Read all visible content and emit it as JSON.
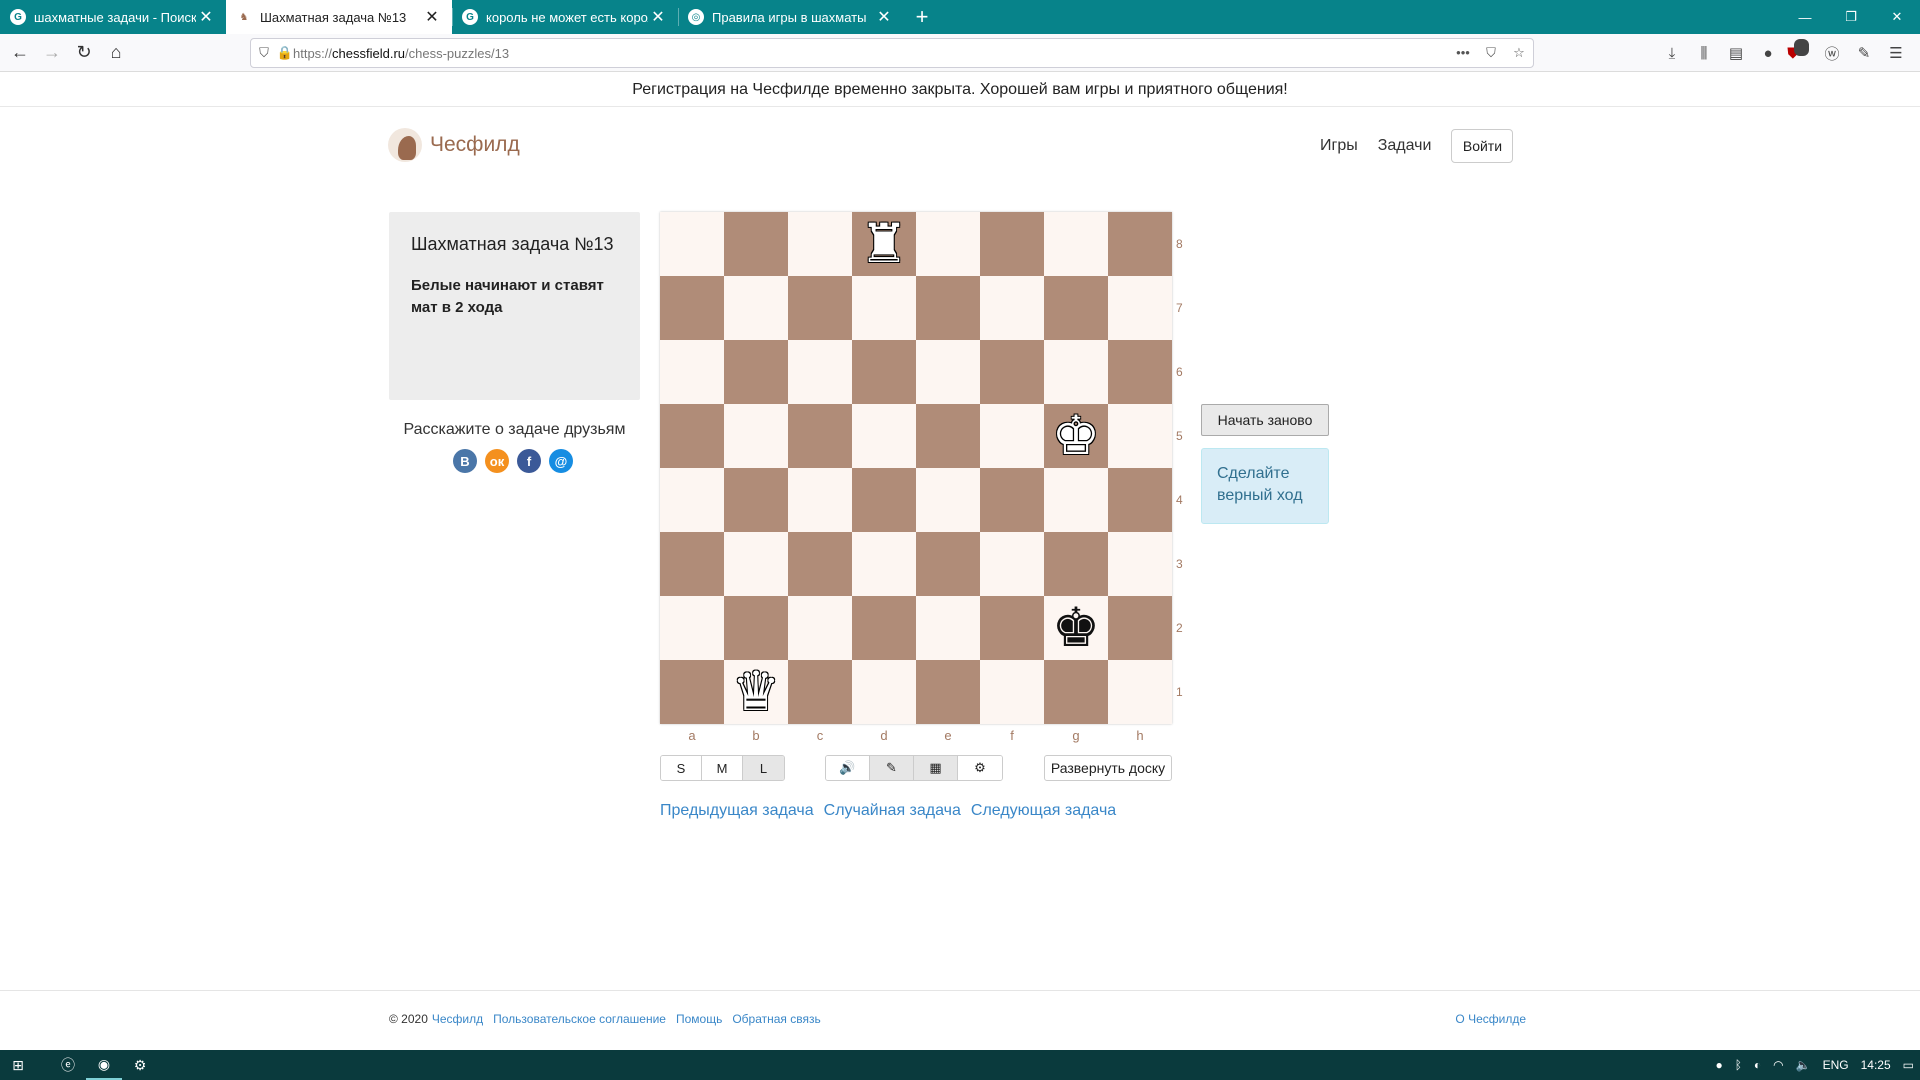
{
  "browser": {
    "tabs": [
      {
        "title": "шахматные задачи - Поиск в",
        "icon": "G",
        "active": false
      },
      {
        "title": "Шахматная задача №13",
        "icon": "♞",
        "active": true
      },
      {
        "title": "король не может есть короля",
        "icon": "G",
        "active": false
      },
      {
        "title": "Правила игры в шахматы",
        "icon": "◎",
        "active": false
      }
    ],
    "new_tab": "+",
    "url": {
      "prefix": "https://",
      "host": "chessfield.ru",
      "path": "/chess-puzzles/13"
    },
    "url_actions": [
      "•••",
      "⛉",
      "☆"
    ],
    "extension_badge": "7"
  },
  "announcement": "Регистрация на Чесфилде временно закрыта. Хорошей вам игры и приятного общения!",
  "header": {
    "logo_text": "Чесфилд",
    "nav": [
      "Игры",
      "Задачи"
    ],
    "login_label": "Войти"
  },
  "puzzle": {
    "title": "Шахматная задача №13",
    "description": "Белые начинают и ставят мат в 2 хода"
  },
  "share": {
    "text": "Расскажите о задаче друзьям",
    "icons": [
      {
        "name": "vk-icon",
        "glyph": "В",
        "color": "#4a76a8"
      },
      {
        "name": "odnoklassniki-icon",
        "glyph": "ок",
        "color": "#f4901e"
      },
      {
        "name": "facebook-icon",
        "glyph": "f",
        "color": "#3b5998"
      },
      {
        "name": "mailru-icon",
        "glyph": "@",
        "color": "#168de2"
      }
    ]
  },
  "board": {
    "files": [
      "a",
      "b",
      "c",
      "d",
      "e",
      "f",
      "g",
      "h"
    ],
    "ranks": [
      "8",
      "7",
      "6",
      "5",
      "4",
      "3",
      "2",
      "1"
    ],
    "colors": {
      "light": "#fdf6f2",
      "dark": "#b08c78"
    },
    "pieces": [
      {
        "square": "d8",
        "piece": "white-rook",
        "glyph": "♜"
      },
      {
        "square": "g5",
        "piece": "white-king",
        "glyph": "♚"
      },
      {
        "square": "g2",
        "piece": "black-king",
        "glyph": "♚"
      },
      {
        "square": "b1",
        "piece": "white-queen",
        "glyph": "♛"
      }
    ]
  },
  "board_controls": {
    "sizes": [
      "S",
      "M",
      "L"
    ],
    "tools": [
      {
        "name": "sound-icon",
        "glyph": "🔊"
      },
      {
        "name": "wand-icon",
        "glyph": "✎"
      },
      {
        "name": "grid-icon",
        "glyph": "▦"
      },
      {
        "name": "settings-icon",
        "glyph": "⚙"
      }
    ],
    "flip_label": "Развернуть доску"
  },
  "puzzle_nav": [
    "Предыдущая задача",
    "Случайная задача",
    "Следующая задача"
  ],
  "side": {
    "restart_label": "Начать заново",
    "hint": "Сделайте верный ход"
  },
  "footer": {
    "copyright": "© 2020",
    "links": [
      "Чесфилд",
      "Пользовательское соглашение",
      "Помощь",
      "Обратная связь"
    ],
    "about": "О Чесфилде"
  },
  "taskbar": {
    "language": "ENG",
    "time": "14:25"
  }
}
